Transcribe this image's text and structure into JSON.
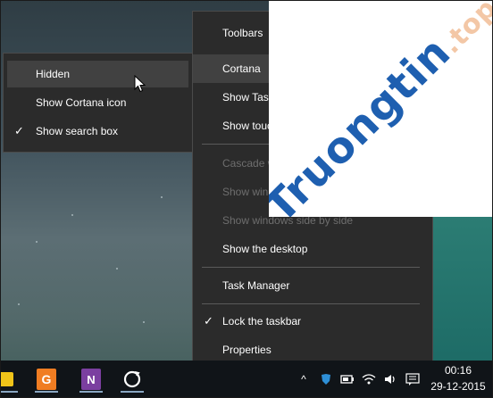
{
  "main_menu": {
    "items": [
      {
        "label": "Toolbars",
        "submenu": true,
        "highlighted": false,
        "disabled": false,
        "checked": false
      },
      {
        "label": "Cortana",
        "submenu": true,
        "highlighted": true,
        "disabled": false,
        "checked": false
      },
      {
        "label": "Show Task",
        "submenu": false,
        "highlighted": false,
        "disabled": false,
        "checked": false
      },
      {
        "label": "Show touc",
        "submenu": false,
        "highlighted": false,
        "disabled": false,
        "checked": false
      },
      {
        "label": "Cascade w",
        "submenu": false,
        "highlighted": false,
        "disabled": true,
        "checked": false
      },
      {
        "label": "Show win",
        "submenu": false,
        "highlighted": false,
        "disabled": true,
        "checked": false
      },
      {
        "label": "Show windows side by side",
        "submenu": false,
        "highlighted": false,
        "disabled": true,
        "checked": false
      },
      {
        "label": "Show the desktop",
        "submenu": false,
        "highlighted": false,
        "disabled": false,
        "checked": false
      },
      {
        "label": "Task Manager",
        "submenu": false,
        "highlighted": false,
        "disabled": false,
        "checked": false
      },
      {
        "label": "Lock the taskbar",
        "submenu": false,
        "highlighted": false,
        "disabled": false,
        "checked": true
      },
      {
        "label": "Properties",
        "submenu": false,
        "highlighted": false,
        "disabled": false,
        "checked": false
      }
    ]
  },
  "cortana_menu": {
    "items": [
      {
        "label": "Hidden",
        "highlighted": true,
        "checked": false
      },
      {
        "label": "Show Cortana icon",
        "highlighted": false,
        "checked": false
      },
      {
        "label": "Show search box",
        "highlighted": false,
        "checked": true
      }
    ]
  },
  "watermark": {
    "text": "Truongtin",
    "suffix": ".top",
    "color": "#1e5fb0"
  },
  "taskbar": {
    "apps": [
      "folder-icon",
      "pdf-app-icon",
      "onenote-icon",
      "sync-app-icon"
    ],
    "tray_chevron": "^",
    "clock": {
      "time": "00:16",
      "date": "29-12-2015"
    }
  },
  "colors": {
    "menu_bg": "#2b2b2b",
    "menu_highlight": "#414141",
    "disabled_text": "#6e6e6e",
    "taskbar_bg": "#101418"
  }
}
